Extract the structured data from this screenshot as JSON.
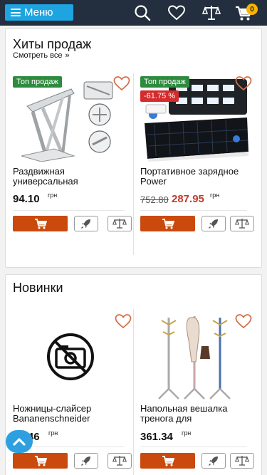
{
  "header": {
    "menu_label": "Меню",
    "cart_count": "0",
    "icons": [
      "search-icon",
      "heart-icon",
      "compare-icon",
      "cart-icon"
    ]
  },
  "hits": {
    "title": "Хиты продаж",
    "see_all": "Смотреть все",
    "products": [
      {
        "badge": "Топ продаж",
        "name": "Раздвижная универсальная",
        "price": "94.10",
        "currency": "грн"
      },
      {
        "badge": "Топ продаж",
        "discount": "-61.75 %",
        "name": "Портативное зарядное Power",
        "old_price": "752.80",
        "price": "287.95",
        "currency": "грн"
      }
    ]
  },
  "new": {
    "title": "Новинки",
    "products": [
      {
        "name": "Ножницы-слайсер Bananenschneider",
        "price": "56.46",
        "currency": "грн"
      },
      {
        "name": "Напольная вешалка тренога для",
        "price": "361.34",
        "currency": "грн"
      }
    ]
  },
  "colors": {
    "header_bg": "#232f3e",
    "accent_blue": "#1ea4e0",
    "buy_orange": "#c94a0c",
    "badge_green": "#2e8b3e",
    "discount_red": "#d32c2c"
  }
}
